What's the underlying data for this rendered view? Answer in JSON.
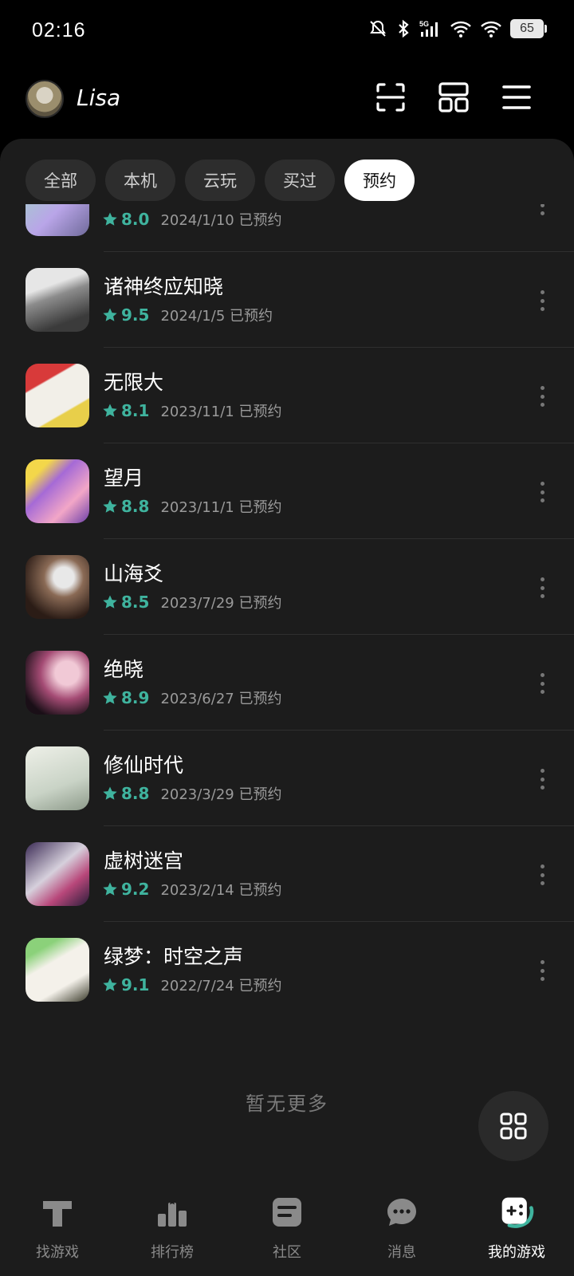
{
  "status": {
    "time": "02:16",
    "battery": "65",
    "network": "5G"
  },
  "header": {
    "username": "Lisa"
  },
  "tabs": [
    {
      "label": "全部"
    },
    {
      "label": "本机"
    },
    {
      "label": "云玩"
    },
    {
      "label": "买过"
    },
    {
      "label": "预约"
    }
  ],
  "games": [
    {
      "title": "",
      "score": "8.0",
      "date": "2024/1/10 已预约"
    },
    {
      "title": "诸神终应知晓",
      "score": "9.5",
      "date": "2024/1/5 已预约"
    },
    {
      "title": "无限大",
      "score": "8.1",
      "date": "2023/11/1 已预约"
    },
    {
      "title": "望月",
      "score": "8.8",
      "date": "2023/11/1 已预约"
    },
    {
      "title": "山海爻",
      "score": "8.5",
      "date": "2023/7/29 已预约"
    },
    {
      "title": "绝晓",
      "score": "8.9",
      "date": "2023/6/27 已预约"
    },
    {
      "title": "修仙时代",
      "score": "8.8",
      "date": "2023/3/29 已预约"
    },
    {
      "title": "虚树迷宫",
      "score": "9.2",
      "date": "2023/2/14 已预约"
    },
    {
      "title": "绿梦：时空之声",
      "score": "9.1",
      "date": "2022/7/24 已预约"
    }
  ],
  "list_footer": "暂无更多",
  "nav": [
    {
      "label": "找游戏"
    },
    {
      "label": "排行榜"
    },
    {
      "label": "社区"
    },
    {
      "label": "消息"
    },
    {
      "label": "我的游戏"
    }
  ],
  "colors": {
    "accent": "#3fb39e",
    "panel": "#1c1c1c"
  }
}
